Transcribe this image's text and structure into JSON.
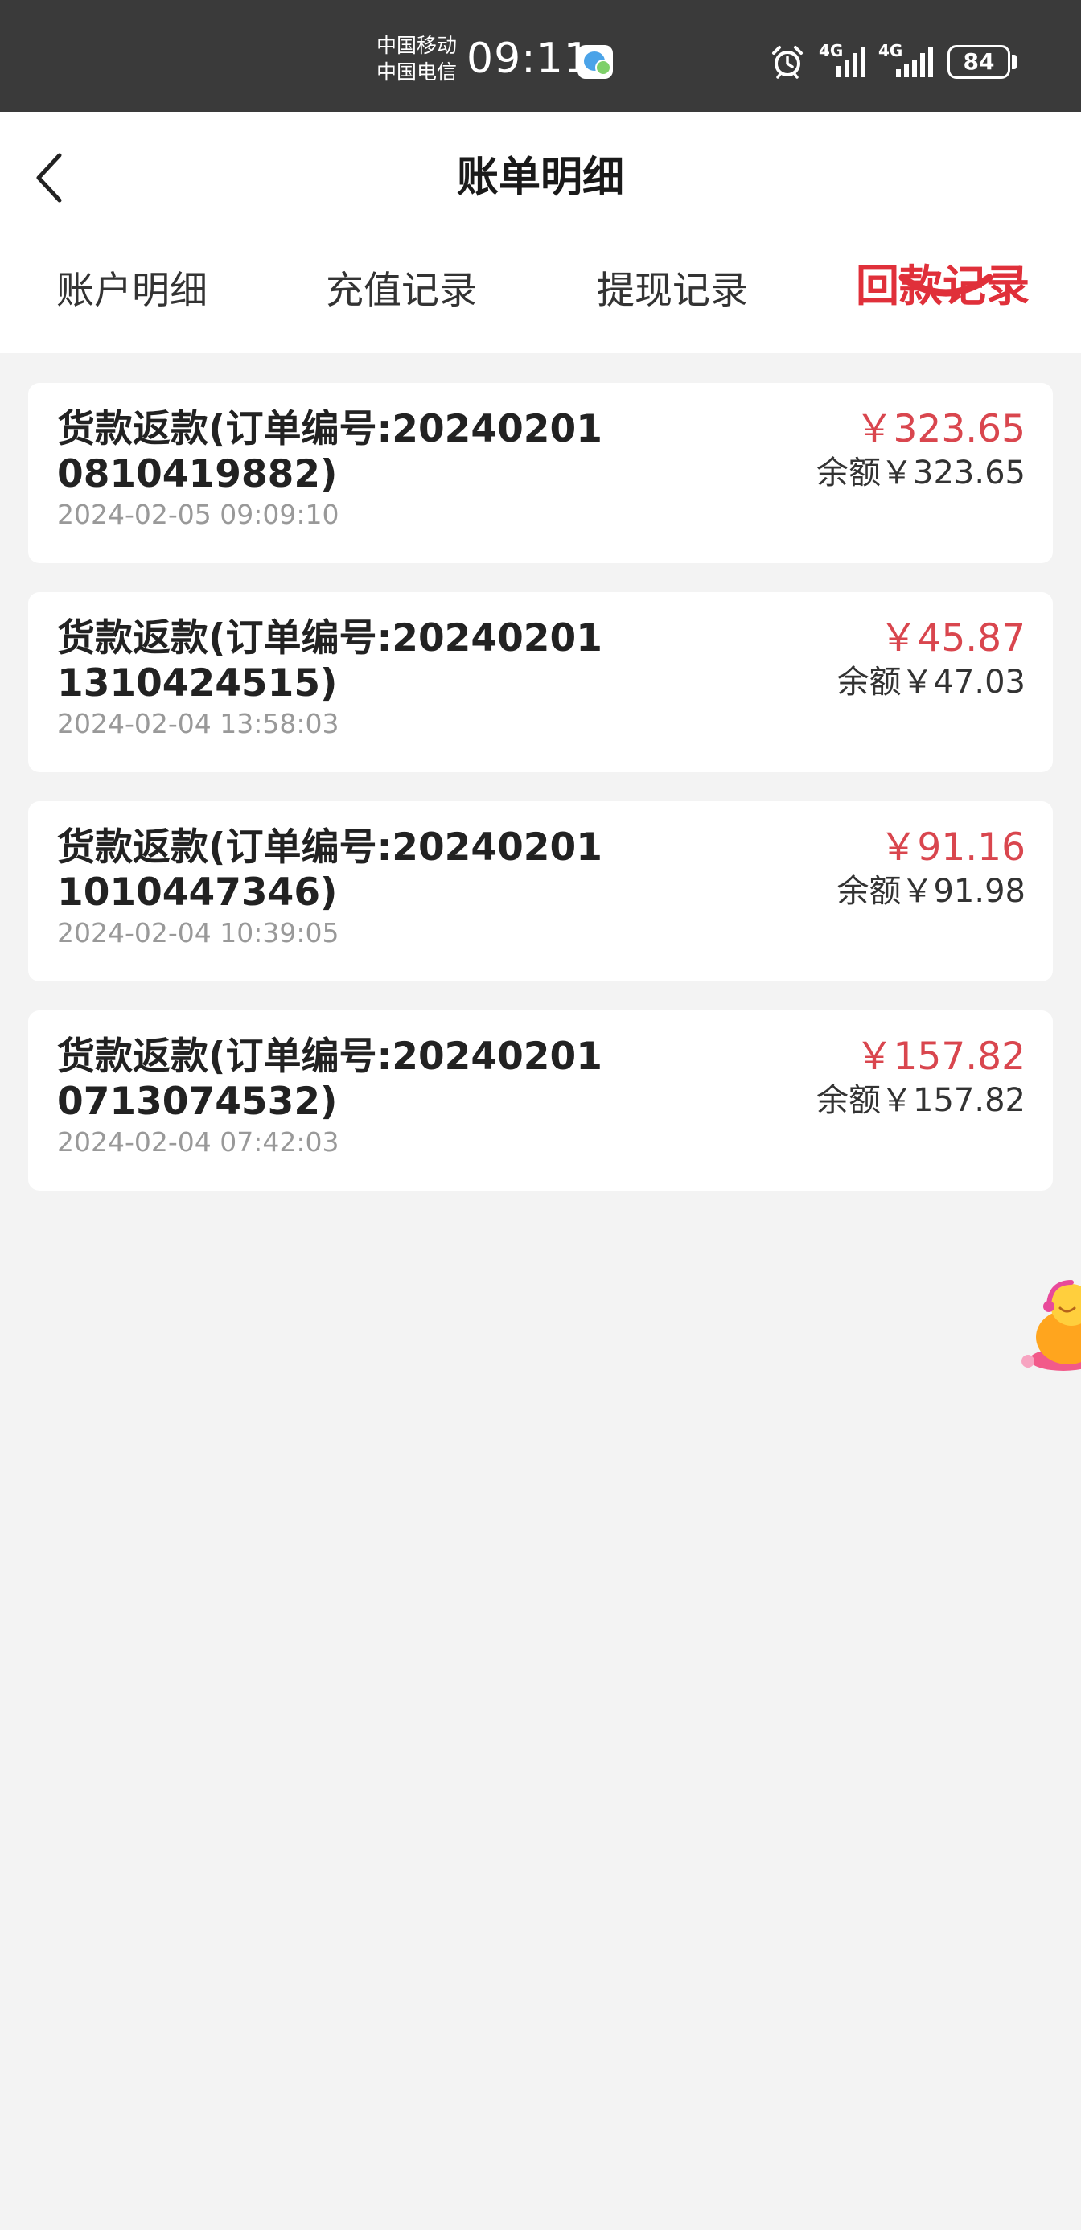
{
  "status_bar": {
    "carrier_1": "中国移动",
    "carrier_2": "中国电信",
    "time": "09:11",
    "sim1_network": "4G",
    "sim2_network": "4G",
    "battery": "84"
  },
  "header": {
    "title": "账单明细",
    "back_icon": "chevron-left-icon"
  },
  "tabs": [
    {
      "label": "账户明细",
      "active": false
    },
    {
      "label": "充值记录",
      "active": false
    },
    {
      "label": "提现记录",
      "active": false
    },
    {
      "label": "回款记录",
      "active": true
    }
  ],
  "records": [
    {
      "title": "货款返款(订单编号:20240201081041988​2)",
      "time": "2024-02-05 09:09:10",
      "amount": "￥323.65",
      "balance": "余额￥323.65"
    },
    {
      "title": "货款返款(订单编号:202402011310424515)",
      "time": "2024-02-04 13:58:03",
      "amount": "￥45.87",
      "balance": "余额￥47.03"
    },
    {
      "title": "货款返款(订单编号:202402011010447346)",
      "time": "2024-02-04 10:39:05",
      "amount": "￥91.16",
      "balance": "余额￥91.98"
    },
    {
      "title": "货款返款(订单编号:202402010713074532)",
      "time": "2024-02-04 07:42:03",
      "amount": "￥157.82",
      "balance": "余额￥157.82"
    }
  ],
  "colors": {
    "accent": "#e0303a",
    "amount": "#d9464e",
    "status_bar": "#3a3a3a",
    "background": "#f3f3f3"
  }
}
